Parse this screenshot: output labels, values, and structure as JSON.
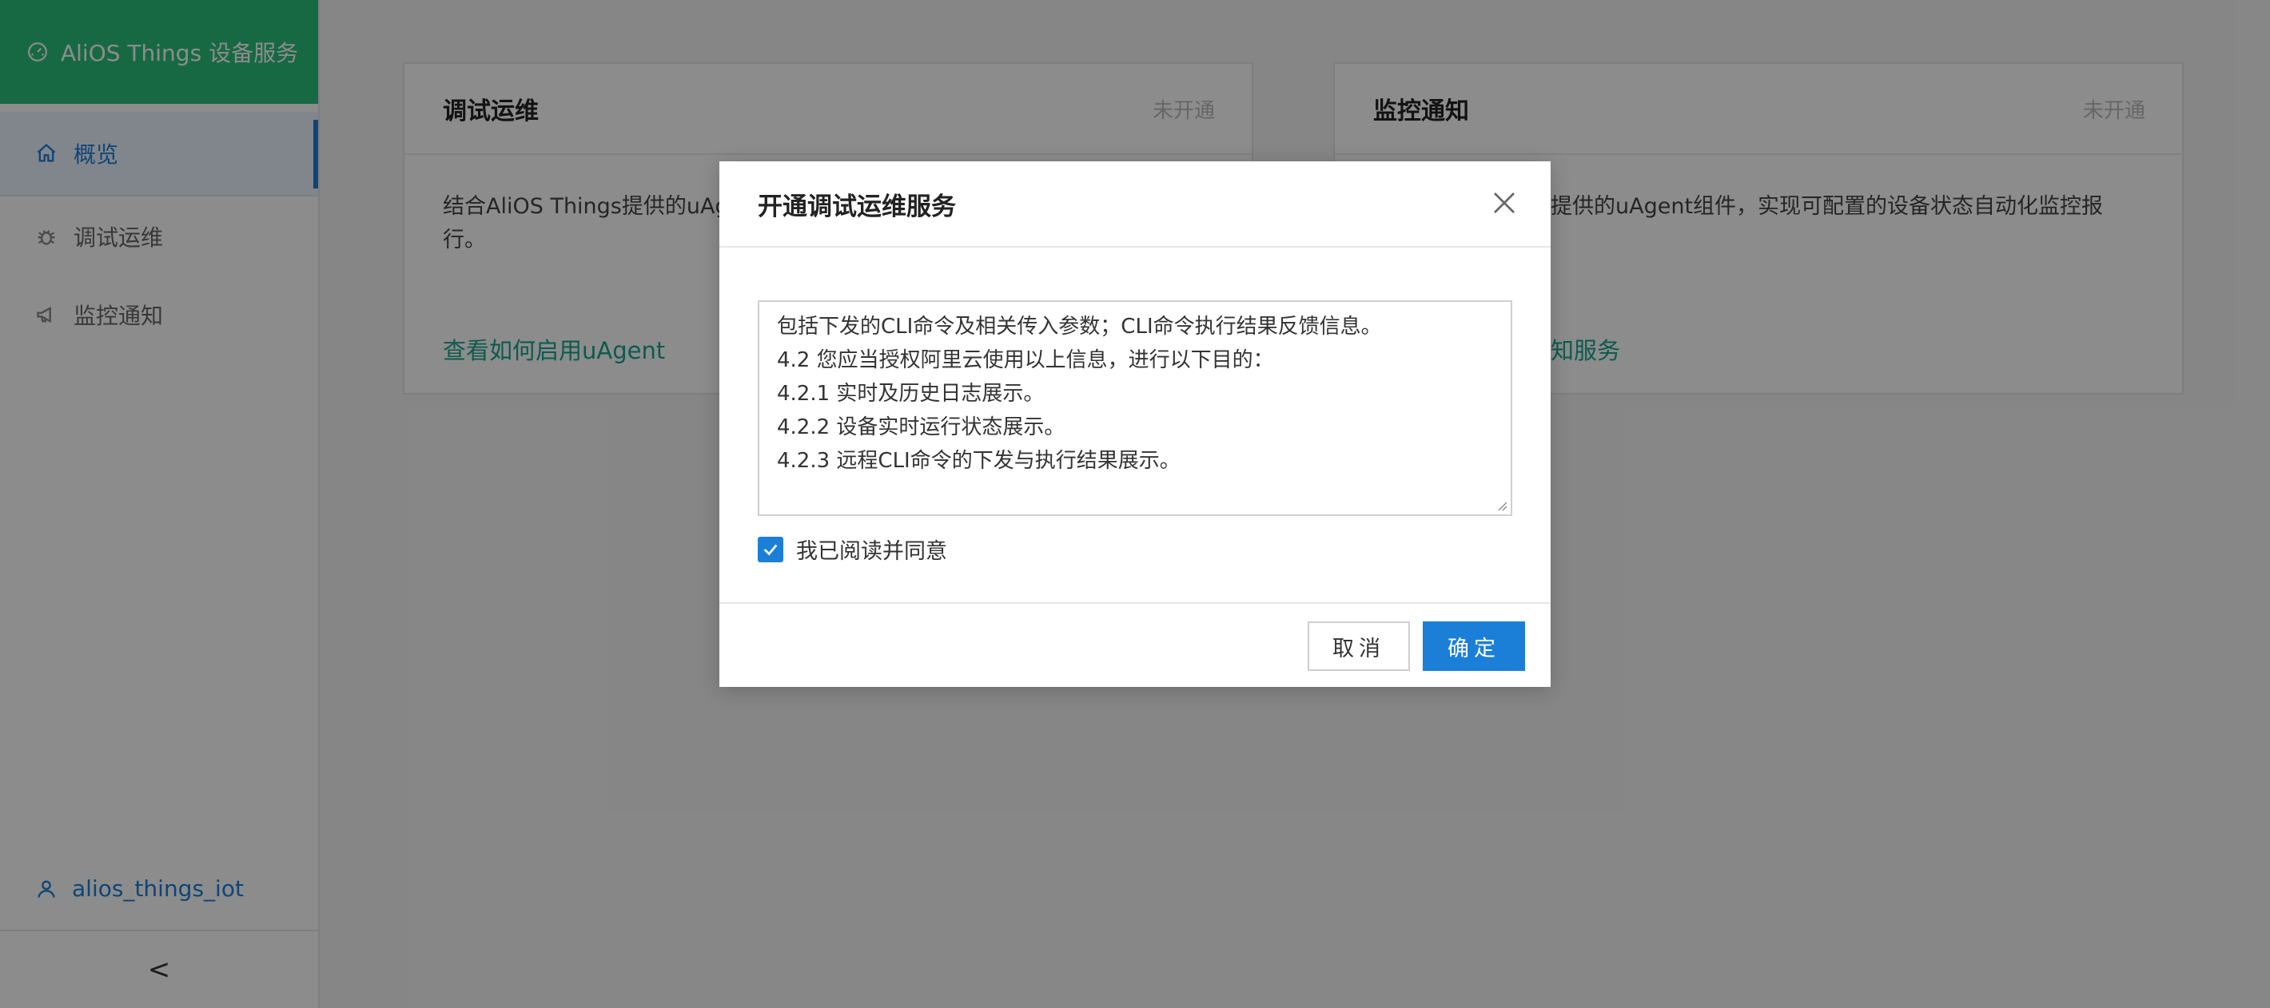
{
  "app": {
    "title": "AliOS Things 设备服务"
  },
  "sidebar": {
    "items": [
      {
        "label": "概览",
        "icon": "home-icon"
      },
      {
        "label": "调试运维",
        "icon": "bug-icon"
      },
      {
        "label": "监控通知",
        "icon": "megaphone-icon"
      }
    ],
    "user": "alios_things_iot",
    "collapse_glyph": "<"
  },
  "cards": [
    {
      "title": "调试运维",
      "status": "未开通",
      "description": "结合AliOS Things提供的uAg",
      "description_line2": "行。",
      "link": "查看如何启用uAgent"
    },
    {
      "title": "监控通知",
      "status": "未开通",
      "description": "提供的uAgent组件，实现可配置的设备状态自动化监控报",
      "link": "知服务"
    }
  ],
  "modal": {
    "title": "开通调试运维服务",
    "terms_lines": [
      "包括下发的CLI命令及相关传入参数；CLI命令执行结果反馈信息。",
      "4.2 您应当授权阿里云使用以上信息，进行以下目的：",
      "4.2.1 实时及历史日志展示。",
      "4.2.2 设备实时运行状态展示。",
      "4.2.3 远程CLI命令的下发与执行结果展示。"
    ],
    "agree_label": "我已阅读并同意",
    "agree_checked": true,
    "cancel_label": "取消",
    "ok_label": "确定"
  },
  "colors": {
    "brand": "#2bc07b",
    "primary": "#1b7fd8",
    "link": "#17a58d"
  }
}
